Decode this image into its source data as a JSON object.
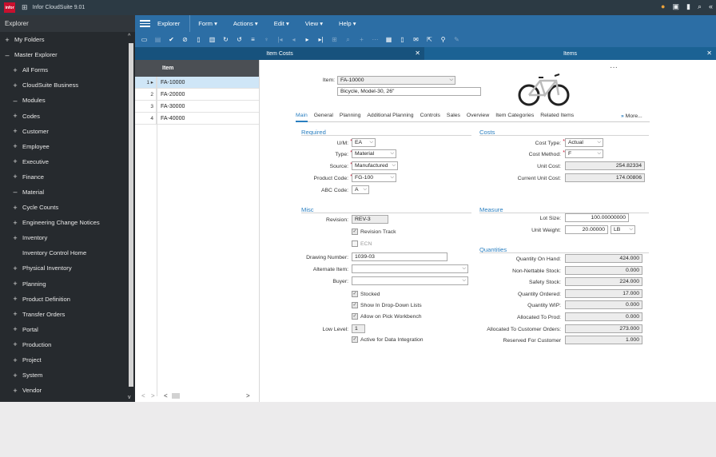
{
  "app": {
    "logo_text": "infor",
    "title": "Infor CloudSuite 9.01"
  },
  "explorer": {
    "title": "Explorer",
    "items": [
      {
        "sym": "+",
        "label": "My Folders",
        "level": 0
      },
      {
        "sym": "–",
        "label": "Master Explorer",
        "level": 0
      },
      {
        "sym": "+",
        "label": "All Forms",
        "level": 1
      },
      {
        "sym": "+",
        "label": "CloudSuite Business",
        "level": 1
      },
      {
        "sym": "–",
        "label": "Modules",
        "level": 1
      },
      {
        "sym": "+",
        "label": "Codes",
        "level": 2
      },
      {
        "sym": "+",
        "label": "Customer",
        "level": 2
      },
      {
        "sym": "+",
        "label": "Employee",
        "level": 2
      },
      {
        "sym": "+",
        "label": "Executive",
        "level": 2
      },
      {
        "sym": "+",
        "label": "Finance",
        "level": 2
      },
      {
        "sym": "–",
        "label": "Material",
        "level": 2
      },
      {
        "sym": "+",
        "label": "Cycle Counts",
        "level": 2
      },
      {
        "sym": "+",
        "label": "Engineering Change Notices",
        "level": 2
      },
      {
        "sym": "+",
        "label": "Inventory",
        "level": 2
      },
      {
        "sym": "",
        "label": "Inventory Control Home",
        "level": 3
      },
      {
        "sym": "+",
        "label": "Physical Inventory",
        "level": 2
      },
      {
        "sym": "+",
        "label": "Planning",
        "level": 2
      },
      {
        "sym": "+",
        "label": "Product Definition",
        "level": 2
      },
      {
        "sym": "+",
        "label": "Transfer Orders",
        "level": 2
      },
      {
        "sym": "+",
        "label": "Portal",
        "level": 2
      },
      {
        "sym": "+",
        "label": "Production",
        "level": 2
      },
      {
        "sym": "+",
        "label": "Project",
        "level": 2
      },
      {
        "sym": "+",
        "label": "System",
        "level": 2
      },
      {
        "sym": "+",
        "label": "Vendor",
        "level": 2
      }
    ]
  },
  "menu": {
    "explorer": "Explorer",
    "form": "Form ▾",
    "actions": "Actions ▾",
    "edit": "Edit ▾",
    "view": "View ▾",
    "help": "Help ▾"
  },
  "tabs": {
    "item_costs": "Item Costs",
    "items": "Items"
  },
  "list": {
    "header": "Item",
    "rows": [
      {
        "num": "1 ▸",
        "val": "FA-10000"
      },
      {
        "num": "2",
        "val": "FA-20000"
      },
      {
        "num": "3",
        "val": "FA-30000"
      },
      {
        "num": "4",
        "val": "FA-40000"
      }
    ]
  },
  "form": {
    "item_label": "Item:",
    "item_value": "FA-10000",
    "description": "Bicycle, Model-30, 26\"",
    "tabs": [
      "Main",
      "General",
      "Planning",
      "Additional Planning",
      "Controls",
      "Sales",
      "Overview",
      "Item Categories",
      "Related Items"
    ],
    "more": "More...",
    "more_arrow": "»",
    "required": {
      "title": "Required",
      "um_label": "U/M:",
      "um": "EA",
      "type_label": "Type:",
      "type": "Material",
      "source_label": "Source:",
      "source": "Manufactured",
      "product_code_label": "Product Code:",
      "product_code": "FG-100",
      "abc_label": "ABC Code:",
      "abc": "A"
    },
    "costs": {
      "title": "Costs",
      "cost_type_label": "Cost Type:",
      "cost_type": "Actual",
      "cost_method_label": "Cost Method:",
      "cost_method": "F",
      "unit_cost_label": "Unit Cost:",
      "unit_cost": "254.82334",
      "current_unit_cost_label": "Current Unit Cost:",
      "current_unit_cost": "174.00806"
    },
    "misc": {
      "title": "Misc",
      "revision_label": "Revision:",
      "revision": "REV-3",
      "revision_track": "Revision Track",
      "ecn": "ECN",
      "drawing_label": "Drawing Number:",
      "drawing": "1039-03",
      "alternate_label": "Alternate Item:",
      "alternate": "",
      "buyer_label": "Buyer:",
      "buyer": "",
      "stocked": "Stocked",
      "show_dropdown": "Show In Drop-Down Lists",
      "allow_pick": "Allow on Pick Workbench",
      "low_level_label": "Low Level:",
      "low_level": "1",
      "active_integration": "Active for Data Integration"
    },
    "measure": {
      "title": "Measure",
      "lot_size_label": "Lot Size:",
      "lot_size": "100.00000000",
      "unit_weight_label": "Unit Weight:",
      "unit_weight": "20.00000",
      "weight_uom": "LB"
    },
    "quantities": {
      "title": "Quantities",
      "rows": [
        {
          "label": "Quantity On Hand:",
          "value": "424.000"
        },
        {
          "label": "Non-Nettable Stock:",
          "value": "0.000"
        },
        {
          "label": "Safety Stock:",
          "value": "224.000"
        },
        {
          "label": "Quantity Ordered:",
          "value": "17.000"
        },
        {
          "label": "Quantity WIP:",
          "value": "0.000"
        },
        {
          "label": "Allocated To Prod:",
          "value": "0.000"
        },
        {
          "label": "Allocated To Customer Orders:",
          "value": "273.000"
        },
        {
          "label": "Reserved For Customer",
          "value": "1.000"
        }
      ]
    }
  }
}
